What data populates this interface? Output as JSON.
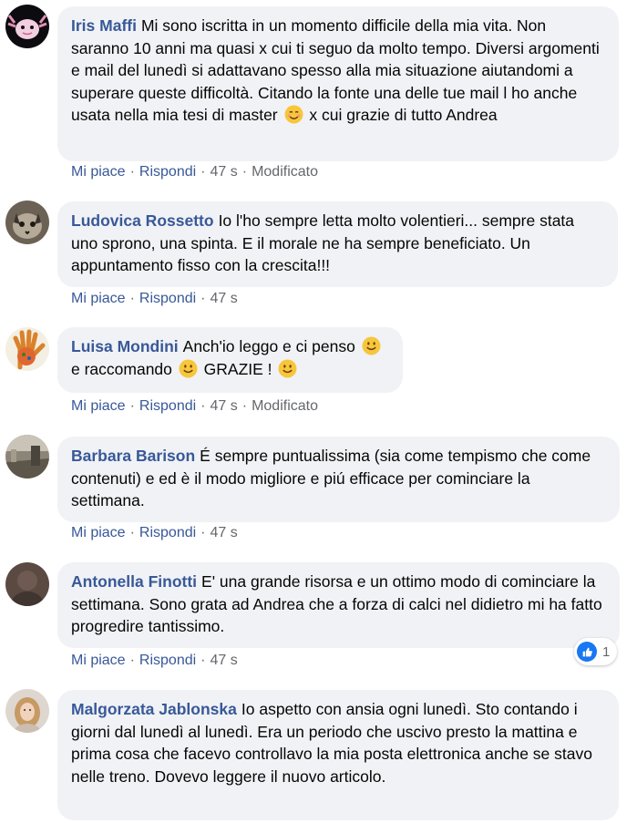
{
  "comments": [
    {
      "author": "Iris Maffi",
      "text_parts": [
        "Mi sono iscritta in un momento difficile della mia vita. Non saranno 10 anni ma quasi x cui ti seguo da molto tempo. Diversi argomenti e mail del lunedì si adattavano spesso alla mia situazione aiutandomi a superare queste difficoltà. Citando la fonte una delle tue mail l ho anche usata nella mia tesi di master",
        "x cui grazie di tutto Andrea"
      ],
      "emoji": "smiling-blush-emoji",
      "actions": {
        "like": "Mi piace",
        "reply": "Rispondi",
        "time": "47 s",
        "edited": "Modificato"
      }
    },
    {
      "author": "Ludovica Rossetto",
      "text": "Io l'ho sempre letta molto volentieri... sempre stata uno sprono, una spinta. E il morale ne ha sempre beneficiato. Un appuntamento fisso con la crescita!!!",
      "actions": {
        "like": "Mi piace",
        "reply": "Rispondi",
        "time": "47 s"
      }
    },
    {
      "author": "Luisa Mondini",
      "text_parts": [
        "Anch'io leggo e ci penso",
        "e raccomando",
        "GRAZIE !"
      ],
      "emoji": "slight-smile-emoji",
      "actions": {
        "like": "Mi piace",
        "reply": "Rispondi",
        "time": "47 s",
        "edited": "Modificato"
      }
    },
    {
      "author": "Barbara Barison",
      "text": "É sempre puntualissima (sia come tempismo che come contenuti) e ed è il modo migliore e piú efficace per cominciare la settimana.",
      "actions": {
        "like": "Mi piace",
        "reply": "Rispondi",
        "time": "47 s"
      }
    },
    {
      "author": "Antonella Finotti",
      "text": "E' una grande risorsa e un ottimo modo di cominciare la settimana. Sono grata ad Andrea che a forza di calci nel didietro mi ha fatto progredire tantissimo.",
      "actions": {
        "like": "Mi piace",
        "reply": "Rispondi",
        "time": "47 s"
      },
      "reaction_count": "1"
    },
    {
      "author": "Malgorzata Jablonska",
      "text": "Io aspetto con ansia ogni lunedì. Sto contando i giorni dal lunedì al lunedì. Era un periodo che uscivo presto la mattina e prima cosa che facevo controllavo la mia posta elettronica anche se stavo nelle treno. Dovevo leggere il nuovo articolo."
    }
  ],
  "colors": {
    "author": "#385898",
    "bubble": "#f0f2f5",
    "meta": "#65676b",
    "like": "#1877f2"
  }
}
